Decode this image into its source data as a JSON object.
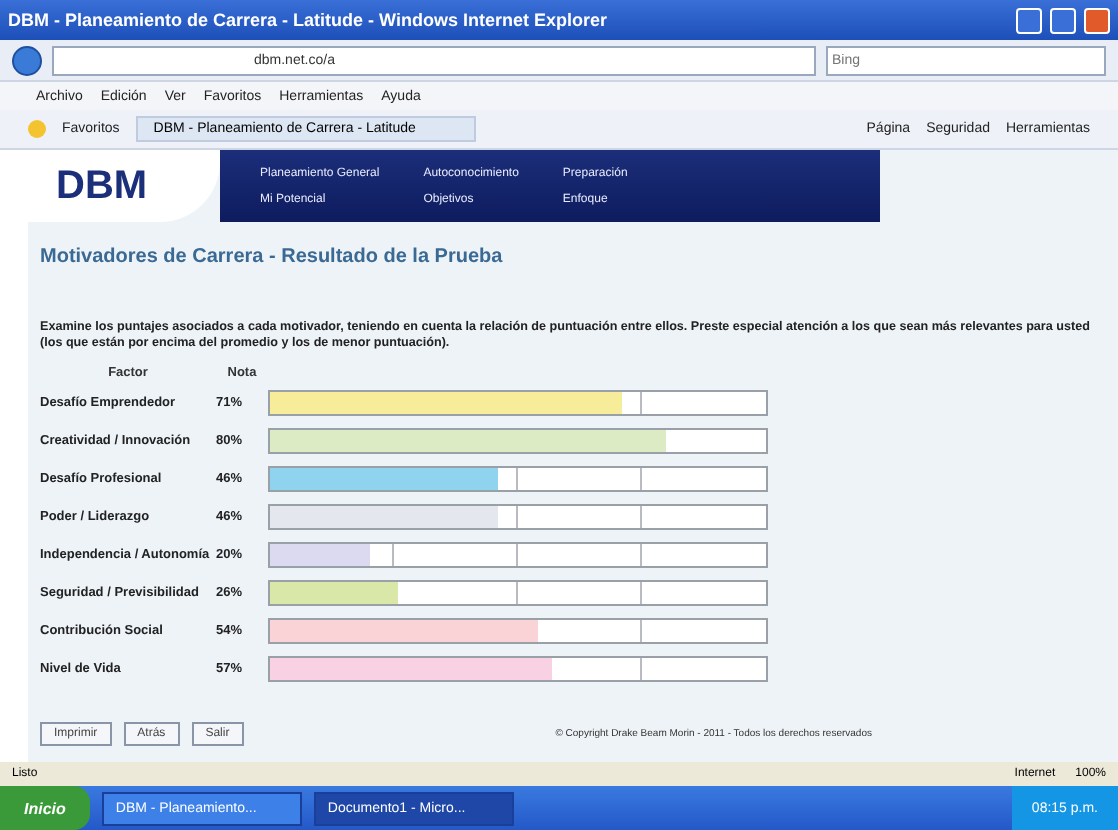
{
  "window": {
    "title": "DBM - Planeamiento de Carrera - Latitude - Windows Internet Explorer"
  },
  "address_bar": {
    "url": "dbm.net.co/a",
    "search_placeholder": "Bing"
  },
  "menu": [
    "Archivo",
    "Edición",
    "Ver",
    "Favoritos",
    "Herramientas",
    "Ayuda"
  ],
  "favorites_bar": {
    "label": "Favoritos",
    "tab": "DBM - Planeamiento de Carrera - Latitude",
    "tools": [
      "Página",
      "Seguridad",
      "Herramientas"
    ]
  },
  "site_nav": {
    "logo": "DBM",
    "rows": [
      [
        "Planeamiento General",
        "Autoconocimiento",
        "Preparación"
      ],
      [
        "Mi Potencial",
        "Objetivos",
        "Enfoque"
      ]
    ]
  },
  "heading": "Motivadores de Carrera - Resultado de la Prueba",
  "instructions": "Examine los puntajes asociados a cada motivador, teniendo en cuenta la relación de puntuación entre ellos. Preste especial atención a los que sean más relevantes para usted (los que están por encima del promedio y los de menor puntuación).",
  "results": {
    "columns": [
      "Factor",
      "Nota"
    ],
    "rows": [
      {
        "factor": "Desafío Emprendedor",
        "score": "71%",
        "level": 0.71,
        "color": "#f7ec9a"
      },
      {
        "factor": "Creatividad / Innovación",
        "score": "80%",
        "level": 0.8,
        "color": "#dcebc4"
      },
      {
        "factor": "Desafío Profesional",
        "score": "46%",
        "level": 0.46,
        "color": "#8fd3ef"
      },
      {
        "factor": "Poder / Liderazgo",
        "score": "46%",
        "level": 0.46,
        "color": "#e4e8ee"
      },
      {
        "factor": "Independencia / Autonomía",
        "score": "20%",
        "level": 0.2,
        "color": "#dcdaf0"
      },
      {
        "factor": "Seguridad / Previsibilidad",
        "score": "26%",
        "level": 0.26,
        "color": "#d9e8a8"
      },
      {
        "factor": "Contribución Social",
        "score": "54%",
        "level": 0.54,
        "color": "#fad3d6"
      },
      {
        "factor": "Nivel de Vida",
        "score": "57%",
        "level": 0.57,
        "color": "#f8d2e2"
      }
    ]
  },
  "buttons": [
    "Imprimir",
    "Atrás",
    "Salir"
  ],
  "footer": "© Copyright Drake Beam Morin - 2011 - Todos los derechos reservados",
  "status_bar": {
    "text": "Listo",
    "zone": "Internet",
    "zoom": "100%"
  },
  "taskbar": {
    "start": "Inicio",
    "tasks": [
      {
        "label": "DBM - Planeamiento...",
        "selected": false
      },
      {
        "label": "Documento1 - Micro...",
        "selected": true
      }
    ],
    "clock": "08:15 p.m."
  }
}
